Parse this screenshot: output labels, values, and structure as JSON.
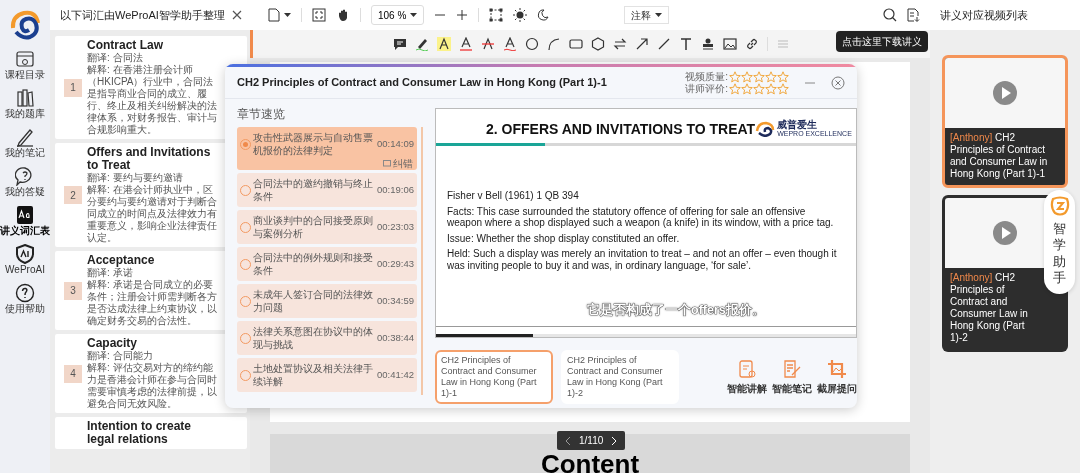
{
  "nav": {
    "items": [
      {
        "label": "课程目录",
        "kind": "catalog",
        "selected": false
      },
      {
        "label": "我的题库",
        "kind": "bank",
        "selected": false
      },
      {
        "label": "我的笔记",
        "kind": "notes",
        "selected": false
      },
      {
        "label": "我的答疑",
        "kind": "qa",
        "selected": false
      },
      {
        "label": "讲义词汇表",
        "kind": "glossary",
        "selected": true
      },
      {
        "label": "WeProAI",
        "kind": "ai",
        "selected": false
      },
      {
        "label": "使用帮助",
        "kind": "help",
        "selected": false
      }
    ]
  },
  "vocab": {
    "title": "以下词汇由WeProAI智学助手整理",
    "terms": [
      {
        "number": "1",
        "term": "Contract Law",
        "translation": "翻译: 合同法",
        "explanation": "解释: 在香港注册会计师（HKICPA）行业中，合同法是指导商业合同的成立、履行、终止及相关纠纷解决的法律体系，对财务报告、审计与合规影响重大。"
      },
      {
        "number": "2",
        "term": "Offers and Invitations to Treat",
        "translation": "翻译: 要约与要约邀请",
        "explanation": "解释: 在港会计师执业中，区分要约与要约邀请对于判断合同成立的时间点及法律效力有重要意义，影响企业法律责任认定。"
      },
      {
        "number": "3",
        "term": "Acceptance",
        "translation": "翻译: 承诺",
        "explanation": "解释: 承诺是合同成立的必要条件；注册会计师需判断各方是否达成法律上约束协议，以确定财务交易的合法性。"
      },
      {
        "number": "4",
        "term": "Capacity",
        "translation": "翻译: 合同能力",
        "explanation": "解释: 评估交易对方的缔约能力是香港会计师在参与合同时需要审慎考虑的法律前提，以避免合同无效风险。"
      },
      {
        "term": "Intention to create legal relations"
      }
    ]
  },
  "viewer": {
    "zoom": "106 %",
    "annotate": "注释",
    "tooltip": "点击这里下载讲义",
    "page": "1/110",
    "next_page_heading": "Content"
  },
  "dialog": {
    "title": "CH2 Principles of Contract and Consumer Law in Hong Kong (Part 1)-1",
    "ratings": [
      {
        "label": "视频质量:",
        "stars": 0
      },
      {
        "label": "讲师评价:",
        "stars": 0
      }
    ],
    "chapters_heading": "章节速览",
    "report": "纠错",
    "chapters": [
      {
        "text": "攻击性武器展示与自动售票机报价的法律判定",
        "time": "00:14:09",
        "selected": true
      },
      {
        "text": "合同法中的邀约撤销与终止条件",
        "time": "00:19:06",
        "selected": false
      },
      {
        "text": "商业谈判中的合同接受原则与案例分析",
        "time": "00:23:03",
        "selected": false
      },
      {
        "text": "合同法中的例外规则和接受条件",
        "time": "00:29:43",
        "selected": false
      },
      {
        "text": "未成年人签订合同的法律效力问题",
        "time": "00:34:59",
        "selected": false
      },
      {
        "text": "法律关系意图在协议中的体现与挑战",
        "time": "00:38:44",
        "selected": false
      },
      {
        "text": "土地处置协议及相关法律手续详解",
        "time": "00:41:42",
        "selected": false
      }
    ],
    "slide": {
      "heading": "2. OFFERS AND INVITATIONS TO TREAT",
      "logo_name": "威普爱生",
      "logo_tagline": "WEPRO EXCELLENCE",
      "paragraphs": [
        "Fisher v Bell (1961) 1 QB 394",
        "Facts: This case surrounded the statutory offence of offering for sale an offensive weapon where a shop displayed such a weapon (a knife) in its window, with a price tag.",
        "Issue: Whether the shop display constituted an offer.",
        "Held: Such a display was merely an invitation to treat – and not an offer – even though it was inviting people to buy it and was, in ordinary language, ‘for sale’."
      ]
    },
    "subtitle": "它是否构成了一个offers报价。",
    "progress": {
      "level": 0.23
    },
    "videos": [
      {
        "title": "CH2 Principles of Contract and Consumer Law in Hong Kong (Part 1)-1",
        "selected": true
      },
      {
        "title": "CH2 Principles of Contract and Consumer Law in Hong Kong (Part 1)-2",
        "selected": false
      }
    ],
    "actions": [
      {
        "label": "智能讲解",
        "kind": "explain"
      },
      {
        "label": "智能笔记",
        "kind": "notes"
      },
      {
        "label": "截屏提问",
        "kind": "capture"
      }
    ]
  },
  "video_list": {
    "title": "讲义对应视频列表",
    "videos": [
      {
        "tag": "[Anthony]",
        "title": "CH2 Principles of Contract and Consumer Law in Hong Kong (Part 1)-1",
        "selected": true
      },
      {
        "tag": "[Anthony]",
        "title": "CH2 Principles of Contract and Consumer Law in Hong Kong (Part 1)-2",
        "selected": false
      }
    ]
  },
  "assistant": {
    "label": "智学助手"
  }
}
